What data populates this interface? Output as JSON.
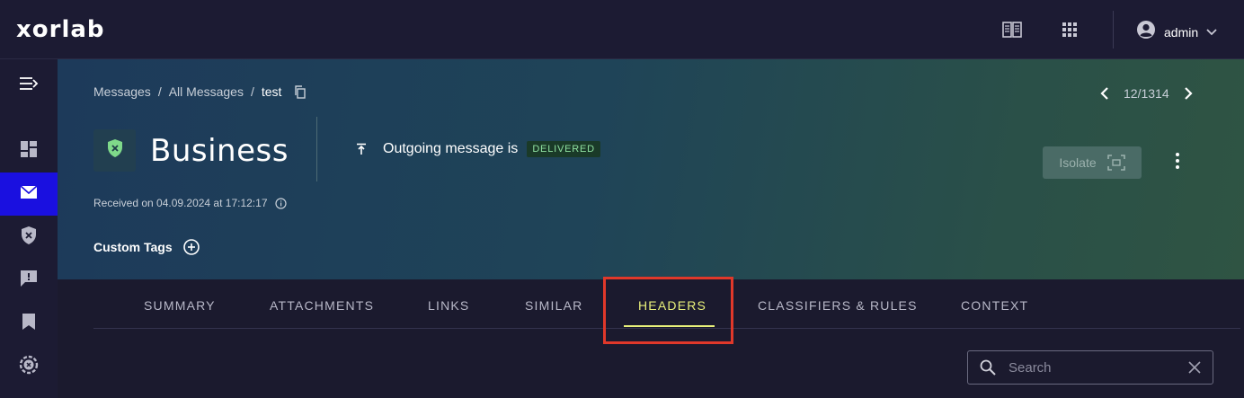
{
  "app": {
    "logo": "xorlab"
  },
  "topbar": {
    "user_name": "admin"
  },
  "breadcrumb": {
    "items": [
      "Messages",
      "All Messages"
    ],
    "current": "test",
    "separator": "/"
  },
  "pager": {
    "position": "12/1314"
  },
  "message": {
    "category": "Business",
    "status_text": "Outgoing message is",
    "status_badge": "DELIVERED",
    "received": "Received on 04.09.2024 at 17:12:17",
    "custom_tags_label": "Custom Tags"
  },
  "actions": {
    "isolate_label": "Isolate"
  },
  "tabs": [
    {
      "label": "SUMMARY",
      "active": false
    },
    {
      "label": "ATTACHMENTS",
      "active": false
    },
    {
      "label": "LINKS",
      "active": false
    },
    {
      "label": "SIMILAR",
      "active": false
    },
    {
      "label": "HEADERS",
      "active": true
    },
    {
      "label": "CLASSIFIERS & RULES",
      "active": false
    },
    {
      "label": "CONTEXT",
      "active": false
    }
  ],
  "search": {
    "placeholder": "Search",
    "value": ""
  },
  "colors": {
    "accent": "#e8f07a",
    "sidebar_active": "#1a10e0",
    "highlight": "#e0382a",
    "delivered": "#8fe0a0"
  }
}
